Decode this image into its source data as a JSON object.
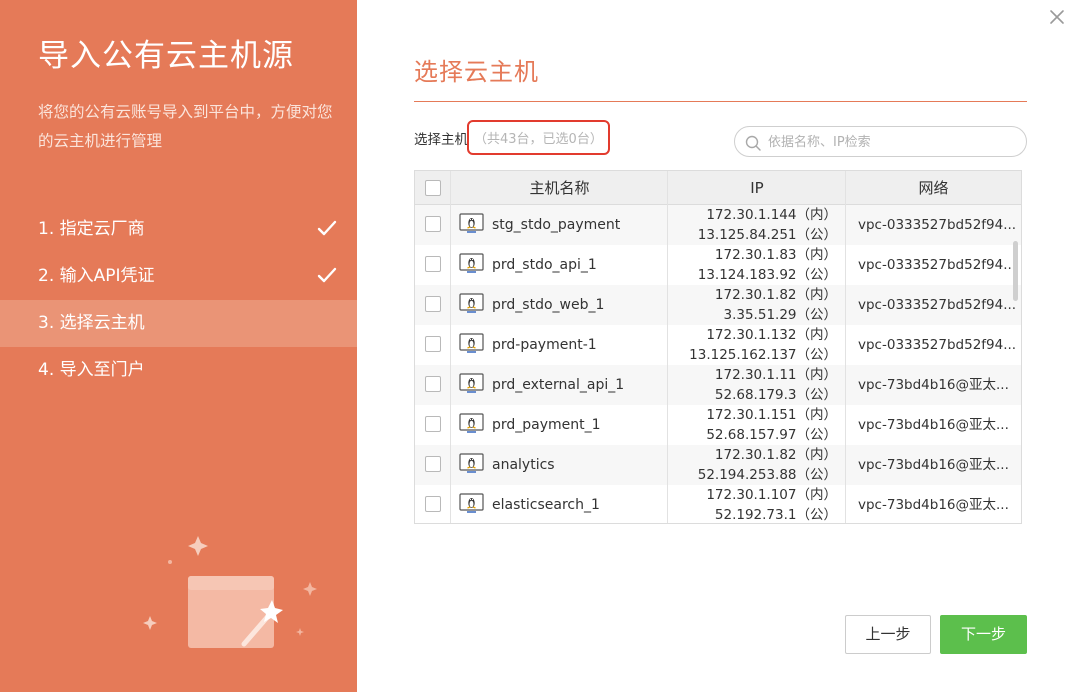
{
  "sidebar": {
    "title": "导入公有云主机源",
    "description": "将您的公有云账号导入到平台中，方便对您的云主机进行管理",
    "steps": [
      {
        "label": "1. 指定云厂商",
        "done": true
      },
      {
        "label": "2. 输入API凭证",
        "done": true
      },
      {
        "label": "3. 选择云主机",
        "active": true
      },
      {
        "label": "4. 导入至门户"
      }
    ],
    "illustration_icon": "magic-wand-window-icon"
  },
  "main": {
    "title": "选择云主机",
    "select_label": "选择主机",
    "select_count": "（共43台，已选0台）",
    "search": {
      "placeholder": "依据名称、IP检索",
      "icon": "search-icon"
    },
    "table": {
      "headers": {
        "name": "主机名称",
        "ip": "IP",
        "network": "网络"
      },
      "rows": [
        {
          "name": "stg_stdo_payment",
          "ip_internal": "172.30.1.144（内）",
          "ip_public": "13.125.84.251（公）",
          "network": "vpc-0333527bd52f94..."
        },
        {
          "name": "prd_stdo_api_1",
          "ip_internal": "172.30.1.83（内）",
          "ip_public": "13.124.183.92（公）",
          "network": "vpc-0333527bd52f94..."
        },
        {
          "name": "prd_stdo_web_1",
          "ip_internal": "172.30.1.82（内）",
          "ip_public": "3.35.51.29（公）",
          "network": "vpc-0333527bd52f94..."
        },
        {
          "name": "prd-payment-1",
          "ip_internal": "172.30.1.132（内）",
          "ip_public": "13.125.162.137（公）",
          "network": "vpc-0333527bd52f94..."
        },
        {
          "name": "prd_external_api_1",
          "ip_internal": "172.30.1.11（内）",
          "ip_public": "52.68.179.3（公）",
          "network": "vpc-73bd4b16@亚太..."
        },
        {
          "name": "prd_payment_1",
          "ip_internal": "172.30.1.151（内）",
          "ip_public": "52.68.157.97（公）",
          "network": "vpc-73bd4b16@亚太..."
        },
        {
          "name": "analytics",
          "ip_internal": "172.30.1.82（内）",
          "ip_public": "52.194.253.88（公）",
          "network": "vpc-73bd4b16@亚太..."
        },
        {
          "name": "elasticsearch_1",
          "ip_internal": "172.30.1.107（内）",
          "ip_public": "52.192.73.1（公）",
          "network": "vpc-73bd4b16@亚太..."
        }
      ]
    },
    "buttons": {
      "prev": "上一步",
      "next": "下一步"
    }
  },
  "colors": {
    "accent": "#e57a58",
    "active_step_bg": "#ea9476",
    "highlight_box": "#e23b2e",
    "next_button": "#5cbf4c"
  }
}
